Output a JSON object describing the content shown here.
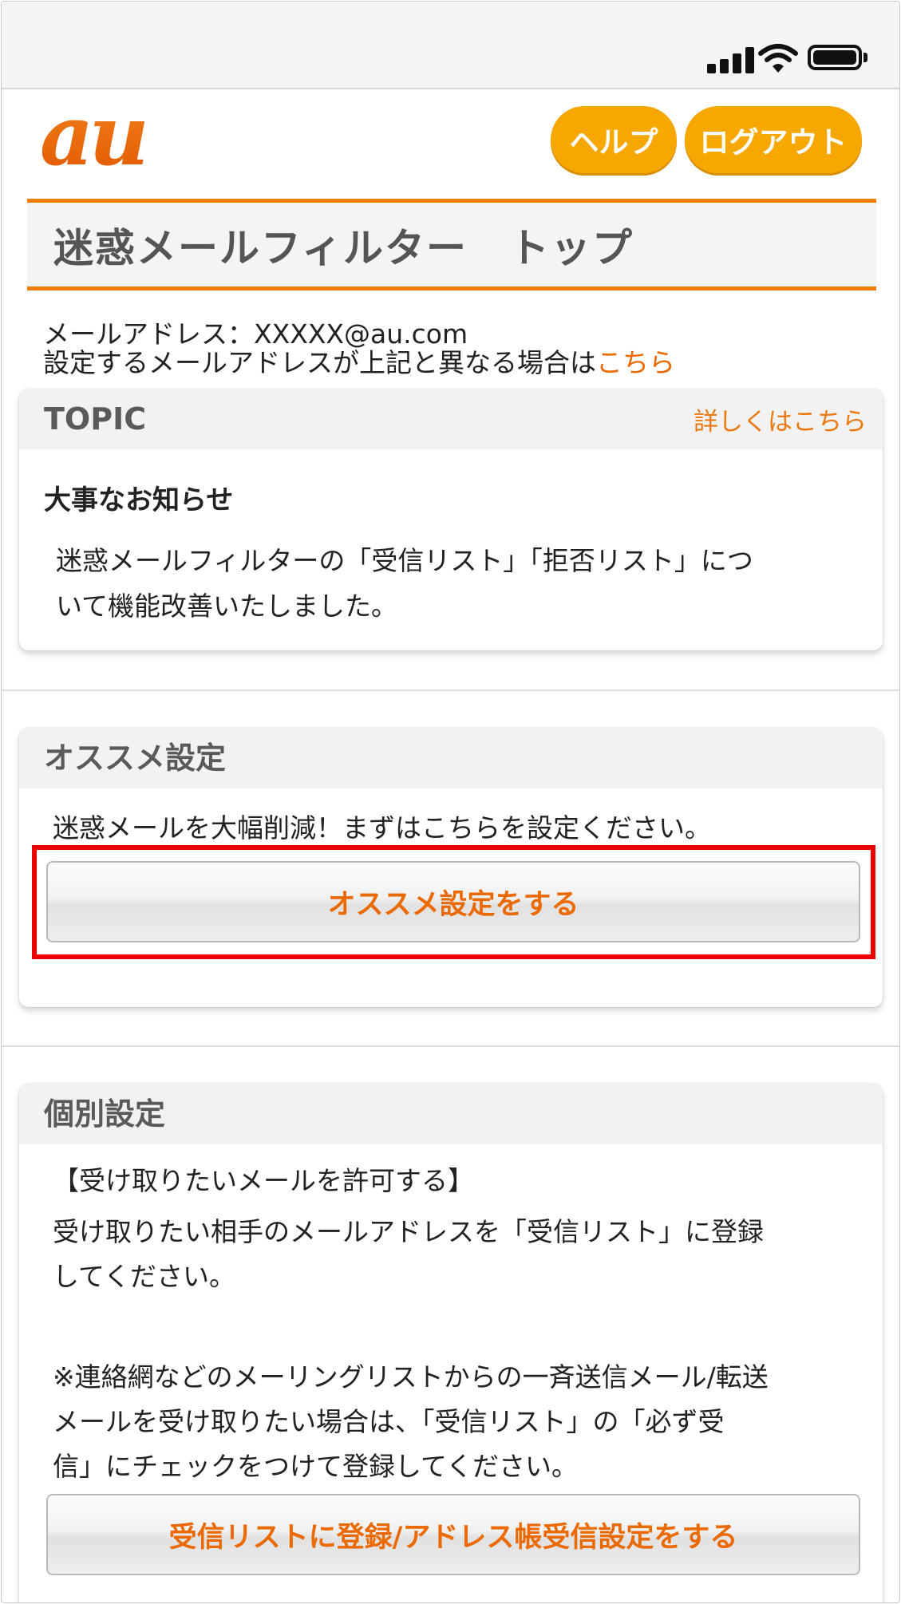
{
  "header": {
    "help_label": "ヘルプ",
    "logout_label": "ログアウト",
    "logo_text": "au"
  },
  "page_title": "迷惑メールフィルター　トップ",
  "account": {
    "mail_address_line": "メールアドレス：XXXXX@au.com",
    "different_address_text": "設定するメールアドレスが上記と異なる場合は",
    "here_link": "こちら"
  },
  "topic": {
    "heading": "TOPIC",
    "details_link": "詳しくはこちら",
    "notice_title": "大事なお知らせ",
    "notice_line1": "迷惑メールフィルターの「受信リスト」「拒否リスト」につ",
    "notice_line2": "いて機能改善いたしました。"
  },
  "recommended": {
    "heading": "オススメ設定",
    "description": "迷惑メールを大幅削減！まずはこちらを設定ください。",
    "button_label": "オススメ設定をする"
  },
  "individual": {
    "heading": "個別設定",
    "allow_heading": "【受け取りたいメールを許可する】",
    "allow_line1": "受け取りたい相手のメールアドレスを「受信リスト」に登録",
    "allow_line2": "してください。",
    "note_line1": "※連絡網などのメーリングリストからの一斉送信メール/転送",
    "note_line2": "メールを受け取りたい場合は、「受信リスト」の「必ず受",
    "note_line3": "信」にチェックをつけて登録してください。",
    "button_label": "受信リストに登録/アドレス帳受信設定をする"
  },
  "colors": {
    "brand_orange": "#f07c00",
    "pill_yellow": "#f7a800",
    "link_orange": "#ea6a00",
    "highlight_red": "#ee0000"
  }
}
